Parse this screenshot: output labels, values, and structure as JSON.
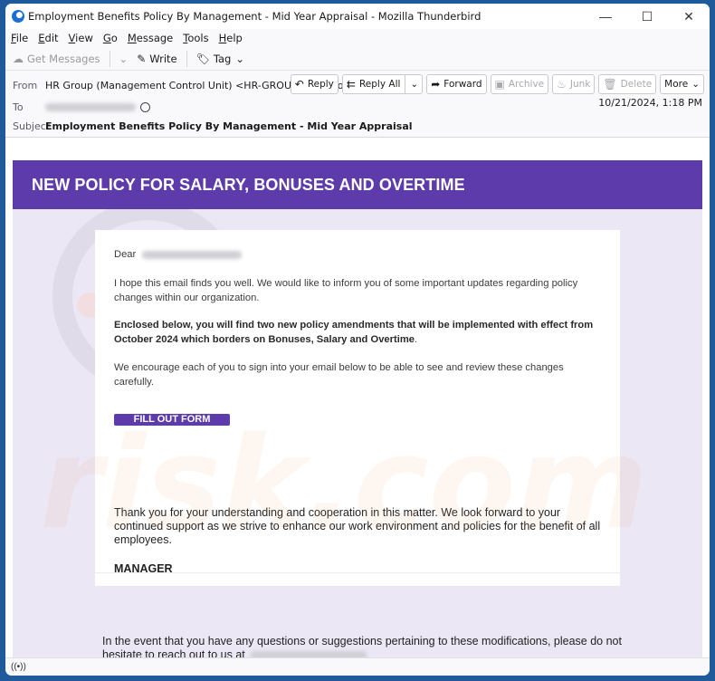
{
  "window": {
    "title": "Employment Benefits Policy By Management - Mid Year Appraisal - Mozilla Thunderbird",
    "controls": {
      "minimize": "—",
      "maximize": "☐",
      "close": "✕"
    }
  },
  "menu": [
    {
      "label": "File",
      "accel": "F",
      "rest": "ile"
    },
    {
      "label": "Edit",
      "accel": "E",
      "rest": "dit"
    },
    {
      "label": "View",
      "accel": "V",
      "rest": "iew"
    },
    {
      "label": "Go",
      "accel": "G",
      "rest": "o"
    },
    {
      "label": "Message",
      "accel": "M",
      "rest": "essage"
    },
    {
      "label": "Tools",
      "accel": "T",
      "rest": "ools"
    },
    {
      "label": "Help",
      "accel": "H",
      "rest": "elp"
    }
  ],
  "toolbar": {
    "get_messages": "Get Messages",
    "write": "Write",
    "tag": "Tag"
  },
  "header": {
    "from_label": "From",
    "from_value": "HR Group (Management Control Unit) <HR-GROUP@mail.com>",
    "to_label": "To",
    "subject_label": "Subject",
    "subject_value": "Employment Benefits Policy By Management - Mid Year Appraisal",
    "date": "10/21/2024, 1:18 PM",
    "actions": {
      "reply": "Reply",
      "reply_all": "Reply All",
      "forward": "Forward",
      "archive": "Archive",
      "junk": "Junk",
      "delete": "Delete",
      "more": "More"
    }
  },
  "email": {
    "banner": "NEW POLICY FOR SALARY, BONUSES AND OVERTIME",
    "greeting": "Dear",
    "para1": "I hope this email finds you well. We would like to inform you of some important updates regarding policy changes within our organization.",
    "para2_bold": "Enclosed below, you will find two new policy amendments that will be implemented with effect from October 2024 which borders on Bonuses, Salary and Overtime",
    "para2_end": ".",
    "para3": "We encourage each of you to sign into your email below to be able to see and review these changes carefully.",
    "cta": "FILL OUT FORM",
    "para4": "Thank you for your understanding and cooperation in this matter. We look forward to your continued support as we strive to enhance our work environment and policies for the benefit of all employees.",
    "signature": "MANAGER",
    "footer": "In the event that you have any questions or suggestions pertaining to these modifications, please do not hesitate to reach out to us at"
  },
  "colors": {
    "brand_purple": "#5e3bab",
    "email_bg": "#ebe7f5",
    "window_frame": "#1f5a9a"
  },
  "status": {
    "activity_icon": "((•))"
  }
}
